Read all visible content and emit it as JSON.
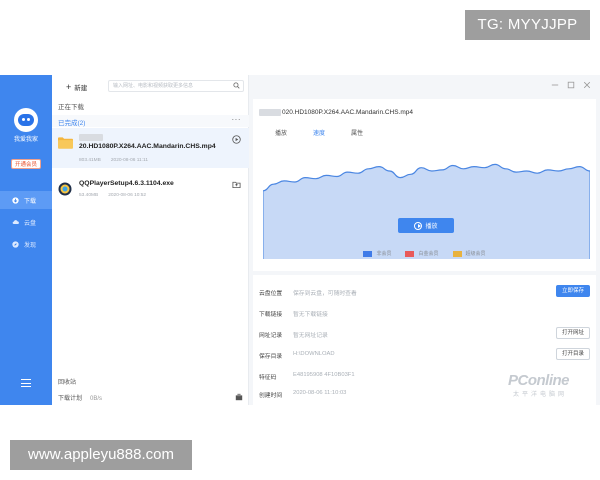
{
  "watermarks": {
    "top": "TG: MYYJJPP",
    "bottom": "www.appleyu888.com"
  },
  "sidebar": {
    "username": "我爱我家",
    "vip_button": "开通会员",
    "items": [
      {
        "label": "下载",
        "icon": "download-icon"
      },
      {
        "label": "云盘",
        "icon": "cloud-icon"
      },
      {
        "label": "发现",
        "icon": "discover-icon"
      }
    ],
    "menu_icon": "hamburger-icon"
  },
  "toolbar": {
    "new_label": "新建",
    "search_placeholder": "输入网址、电影和视频获取更多信息"
  },
  "sections": {
    "downloading": "正在下载",
    "completed": "已完成(2)",
    "more": "···"
  },
  "files": [
    {
      "name": "20.HD1080P.X264.AAC.Mandarin.CHS.mp4",
      "size": "803.41MB",
      "date": "2020-08-06 11:11",
      "icon": "folder-icon",
      "action_icon": "play-circle-icon"
    },
    {
      "name": "QQPlayerSetup4.6.3.1104.exe",
      "size": "53.40MB",
      "date": "2020-08-06 10:52",
      "icon": "qq-icon",
      "action_icon": "open-folder-icon"
    }
  ],
  "footer": {
    "recycle": "回收站",
    "download_plan": "下载计划",
    "speed": "0B/s"
  },
  "detail": {
    "file_title": "020.HD1080P.X264.AAC.Mandarin.CHS.mp4",
    "tabs": [
      "播放",
      "速度",
      "属性"
    ],
    "active_tab": 1,
    "play_button": "播放",
    "legend": [
      {
        "label": "非会员",
        "color": "#3f7be8"
      },
      {
        "label": "白金会员",
        "color": "#e85a5a"
      },
      {
        "label": "超级会员",
        "color": "#e8b23f"
      }
    ]
  },
  "chart_data": {
    "type": "area",
    "values": [
      0.62,
      0.68,
      0.71,
      0.7,
      0.74,
      0.73,
      0.76,
      0.75,
      0.79,
      0.78,
      0.82,
      0.84,
      0.8,
      0.74,
      0.77,
      0.83,
      0.8,
      0.81,
      0.85,
      0.82,
      0.84,
      0.83,
      0.86,
      0.82,
      0.79,
      0.8,
      0.78,
      0.81,
      0.8,
      0.82,
      0.84,
      0.8
    ],
    "series_color": "#4a86e2",
    "fill_color": "#c7d9f6",
    "ylim": [
      0,
      1
    ]
  },
  "info": [
    {
      "key": "云盘位置",
      "value": "保存到云盘，可随时查看",
      "button": "立即保存",
      "primary": true
    },
    {
      "key": "下载链接",
      "value": "暂无下载链接",
      "button": ""
    },
    {
      "key": "网址记录",
      "value": "暂无网址记录",
      "button": "打开网址"
    },
    {
      "key": "保存目录",
      "value": "H:\\DOWNLOAD",
      "button": "打开目录"
    },
    {
      "key": "特征码",
      "value": "E48195908 4F10B03F1",
      "button": ""
    },
    {
      "key": "创建时间",
      "value": "2020-08-06 11:10:03",
      "button": ""
    }
  ],
  "branding": {
    "logo": "PConline",
    "sub": "太平洋电脑网"
  }
}
